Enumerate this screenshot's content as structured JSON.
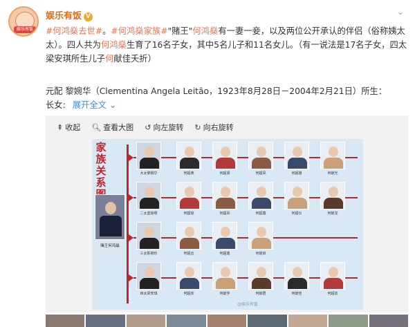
{
  "post": {
    "author": "娱乐有饭",
    "verified_mark": "V",
    "avatar_badge": "娱乐有饭",
    "tag1": "#何鸿燊去世#",
    "tag2": "#何鸿燊家族#",
    "quote_title": "\"赌王\"",
    "name1": "何鸿燊",
    "text1": "有一妻一妾，以及两位公开承认的伴侣（俗称姨太太）。四人共为",
    "name2": "何鸿燊",
    "text2": "生育了16名子女，其中5名儿子和11名女儿。（有一说法是17名子女，四太梁安琪所生儿子",
    "name3": "何",
    "text3": "献佳夭折）",
    "line2": "元配 黎婉华（Clementina Angela Leitão，1923年8月28日－2004年2月21日）所生：",
    "line3_label": "长女:",
    "expand_label": "展开全文",
    "expand_icon": "chevron-down-icon"
  },
  "toolbar": {
    "collapse_label": "收起",
    "view_large_label": "查看大图",
    "rotate_left_label": "向左旋转",
    "rotate_right_label": "向右旋转"
  },
  "chart": {
    "title": "家族关系图",
    "father_caption": "赌王何鸿燊",
    "watermark": "@娱乐有饭",
    "rows": [
      {
        "mother": "大太黎婉华",
        "children": [
          "何超英",
          "何超贤",
          "何超凤",
          "何超雄",
          "何猷光"
        ]
      },
      {
        "mother": "二太蓝琼缨",
        "children": [
          "何超琼",
          "何超凤",
          "何超蕸",
          "何超仪",
          "何猷龙"
        ]
      },
      {
        "mother": "三太陈婉珍",
        "children": [
          "何超云",
          "何超莲",
          "何猷启"
        ]
      },
      {
        "mother": "四太梁安琪",
        "children": [
          "何超欣",
          "何猷亨",
          "何猷君",
          "何猷佳",
          "何超妏"
        ]
      }
    ]
  },
  "more_icon": "chevron-down-icon"
}
